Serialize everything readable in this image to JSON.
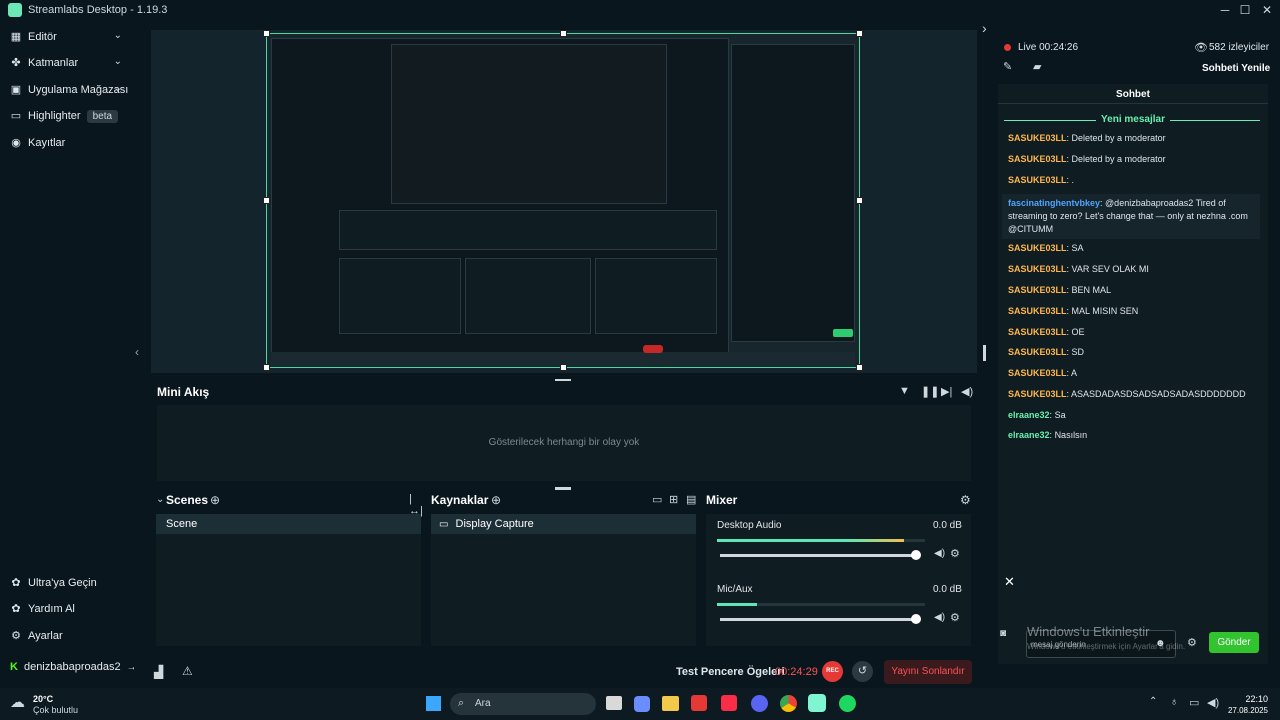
{
  "app": {
    "title": "Streamlabs Desktop - 1.19.3"
  },
  "nav": {
    "items": [
      {
        "label": "Editör"
      },
      {
        "label": "Katmanlar"
      },
      {
        "label": "Uygulama Mağazası"
      },
      {
        "label": "Highlighter",
        "badge": "beta"
      },
      {
        "label": "Kayıtlar"
      }
    ],
    "bottom": [
      {
        "label": "Ultra'ya Geçin"
      },
      {
        "label": "Yardım Al"
      },
      {
        "label": "Ayarlar"
      },
      {
        "label": "denizbabaproadas2"
      }
    ]
  },
  "miniflow": {
    "title": "Mini Akış",
    "empty": "Gösterilecek herhangi bir olay yok"
  },
  "scenes": {
    "title": "Scenes",
    "items": [
      "Scene"
    ]
  },
  "sources": {
    "title": "Kaynaklar",
    "items": [
      "Display Capture"
    ]
  },
  "mixer": {
    "title": "Mixer",
    "channels": [
      {
        "name": "Desktop Audio",
        "db": "0.0 dB",
        "level": 0.9,
        "volume": 1.0
      },
      {
        "name": "Mic/Aux",
        "db": "0.0 dB",
        "level": 0.3,
        "volume": 1.0
      }
    ]
  },
  "bottom": {
    "test_label": "Test Pencere Ögeleri",
    "timer": "00:24:29",
    "rec": "REC",
    "end_stream": "Yayını Sonlandır"
  },
  "chat": {
    "live_label": "Live 00:24:26",
    "viewers": "582 izleyiciler",
    "refresh": "Sohbeti Yenile",
    "title": "Sohbet",
    "new_messages": "Yeni mesajlar",
    "messages": [
      {
        "user": "SASUKE03LL",
        "text": "Deleted by a moderator",
        "color": "orange"
      },
      {
        "user": "SASUKE03LL",
        "text": "Deleted by a moderator",
        "color": "orange"
      },
      {
        "user": "SASUKE03LL",
        "text": ".",
        "color": "orange"
      },
      {
        "user": "fascinatinghentvbkey",
        "text": "@denizbabaproadas2 Tired of streaming to zero? Let's change that — only at nezhna .com @CITUMM",
        "color": "blue"
      },
      {
        "user": "SASUKE03LL",
        "text": "SA",
        "color": "orange"
      },
      {
        "user": "SASUKE03LL",
        "text": "VAR SEV OLAK MI",
        "color": "orange"
      },
      {
        "user": "SASUKE03LL",
        "text": "BEN MAL",
        "color": "orange"
      },
      {
        "user": "SASUKE03LL",
        "text": "MAL MISIN SEN",
        "color": "orange"
      },
      {
        "user": "SASUKE03LL",
        "text": "OE",
        "color": "orange"
      },
      {
        "user": "SASUKE03LL",
        "text": "SD",
        "color": "orange"
      },
      {
        "user": "SASUKE03LL",
        "text": "A",
        "color": "orange"
      },
      {
        "user": "SASUKE03LL",
        "text": "ASASDADASDSADSADSADASDDDDDDD",
        "color": "orange"
      },
      {
        "user": "elraane32",
        "text": "Sa",
        "color": "green"
      },
      {
        "user": "elraane32",
        "text": "Nasılsın",
        "color": "green"
      }
    ],
    "input_placeholder": "mesaj gönderin",
    "watermark_1": "Windows'u Etkinleştir",
    "watermark_2": "Windows'u etkinleştirmek için Ayarlar'a gidin.",
    "send": "Gönder"
  },
  "taskbar": {
    "weather_temp": "20°C",
    "weather_desc": "Çok bulutlu",
    "search": "Ara",
    "time": "22:10",
    "date": "27.08.2025"
  }
}
